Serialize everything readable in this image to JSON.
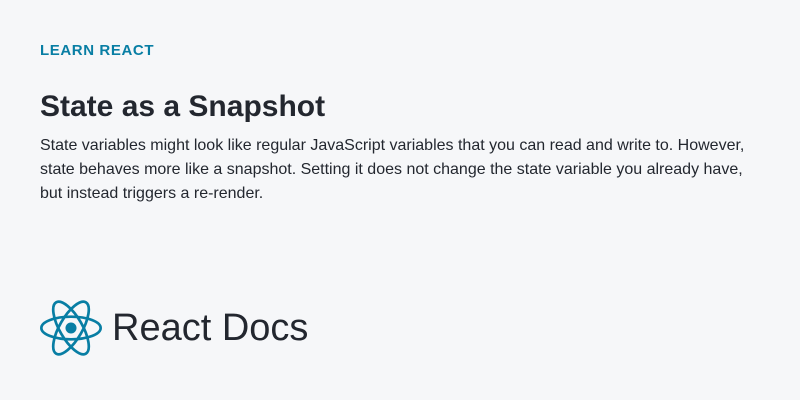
{
  "eyebrow": "LEARN REACT",
  "title": "State as a Snapshot",
  "description": "State variables might look like regular JavaScript variables that you can read and write to. However, state behaves more like a snapshot. Setting it does not change the state variable you already have, but instead triggers a re-render.",
  "brand": {
    "name": "React Docs",
    "icon": "react-atom-icon"
  },
  "colors": {
    "background": "#f6f7f9",
    "accent": "#087ea4",
    "text": "#23272f"
  }
}
